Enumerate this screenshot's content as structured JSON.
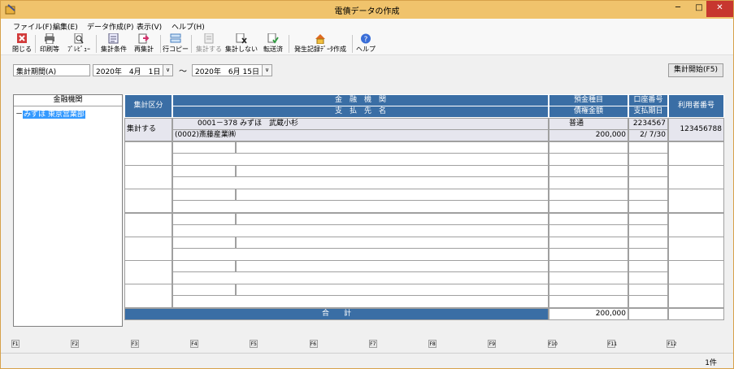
{
  "window": {
    "title": "電債データの作成",
    "min": "─",
    "max": "□",
    "close": "✕"
  },
  "menu": [
    {
      "label": "ファイル(F)"
    },
    {
      "label": "編集(E)"
    },
    {
      "label": "データ作成(P)"
    },
    {
      "label": "表示(V)"
    },
    {
      "label": "ヘルプ(H)"
    }
  ],
  "toolbar": [
    {
      "label": "閉じる",
      "icon": "close-red-icon",
      "disabled": false
    },
    {
      "label": "印刷等",
      "icon": "printer-icon",
      "disabled": false
    },
    {
      "label": "ﾌﾟﾚﾋﾞｭｰ",
      "icon": "preview-icon",
      "disabled": false
    },
    {
      "label": "集計条件",
      "icon": "conditions-icon",
      "disabled": false
    },
    {
      "label": "再集計",
      "icon": "recalc-icon",
      "disabled": false
    },
    {
      "label": "行コピー",
      "icon": "copy-row-icon",
      "disabled": false
    },
    {
      "label": "集計する",
      "icon": "aggregate-icon",
      "disabled": true
    },
    {
      "label": "集計しない",
      "icon": "no-aggregate-icon",
      "disabled": false
    },
    {
      "label": "転送済",
      "icon": "transferred-icon",
      "disabled": false
    },
    {
      "label": "発生記録ﾃﾞｰﾀ作成",
      "icon": "create-record-icon",
      "disabled": false
    },
    {
      "label": "ヘルプ",
      "icon": "help-icon",
      "disabled": false
    }
  ],
  "period": {
    "label": "集計期間(A)",
    "from": "2020年　4月　1日",
    "to": "2020年　6月 15日",
    "separator": "～",
    "dropdown": "∨"
  },
  "start_button": "集計開始(F5)",
  "tree": {
    "header": "金融機関",
    "node": "みずほ 東京営業部",
    "prefix": "－"
  },
  "grid": {
    "headers": {
      "category": "集計区分",
      "bank": "金　融　機　関",
      "payee": "支　払　先　名",
      "deposit_type": "預金種目",
      "amount": "債権金額",
      "account_no": "口座番号",
      "due_date": "支払期日",
      "user_no": "利用者番号"
    },
    "row1": {
      "category": "集計する",
      "bank": "0001－378 みずほ　武蔵小杉",
      "payee": "(0002)斎藤産業㈱",
      "deposit_type": "普通",
      "amount": "200,000",
      "account_no": "2234567",
      "due_date": "2/ 7/30",
      "user_no": "123456788"
    },
    "total_label": "合　　計",
    "total_amount": "200,000"
  },
  "fkeys": [
    "F1",
    "F2",
    "F3",
    "F4",
    "F5",
    "F6",
    "F7",
    "F8",
    "F9",
    "F10",
    "F11",
    "F12"
  ],
  "status": {
    "count": "1件"
  }
}
